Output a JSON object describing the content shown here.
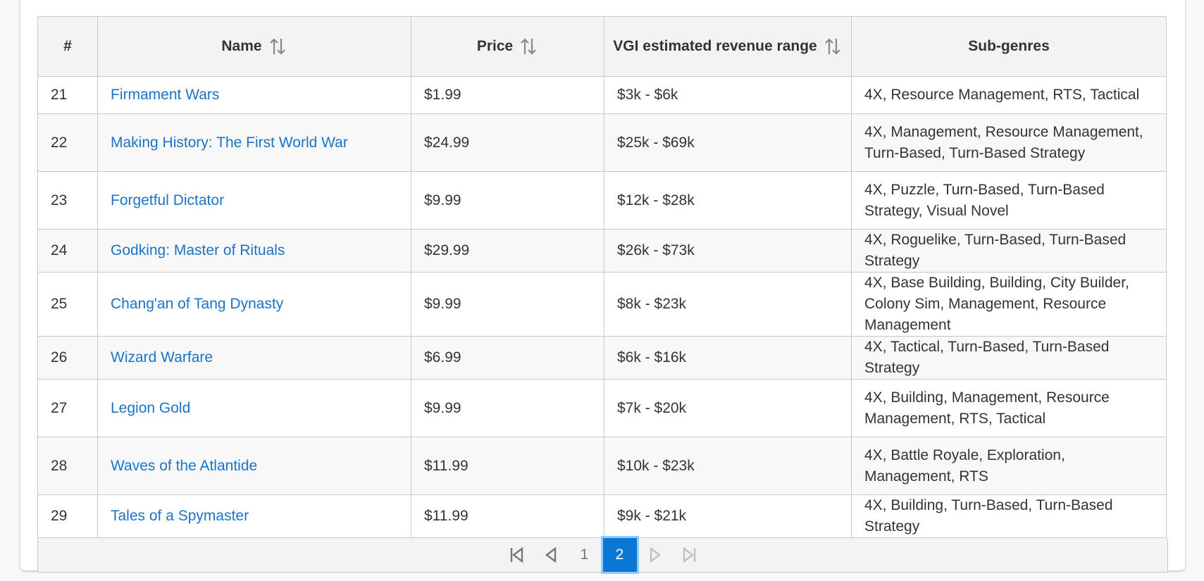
{
  "table": {
    "headers": [
      {
        "label": "#",
        "sortable": false
      },
      {
        "label": "Name",
        "sortable": true
      },
      {
        "label": "Price",
        "sortable": true
      },
      {
        "label": "VGI estimated revenue range",
        "sortable": true
      },
      {
        "label": "Sub-genres",
        "sortable": false
      }
    ],
    "rows": [
      {
        "num": "21",
        "name": "Firmament Wars",
        "price": "$1.99",
        "revenue": "$3k - $6k",
        "subgenres": "4X, Resource Management, RTS, Tactical"
      },
      {
        "num": "22",
        "name": "Making History: The First World War",
        "price": "$24.99",
        "revenue": "$25k - $69k",
        "subgenres": "4X, Management, Resource Management, Turn-Based, Turn-Based Strategy"
      },
      {
        "num": "23",
        "name": "Forgetful Dictator",
        "price": "$9.99",
        "revenue": "$12k - $28k",
        "subgenres": "4X, Puzzle, Turn-Based, Turn-Based Strategy, Visual Novel"
      },
      {
        "num": "24",
        "name": "Godking: Master of Rituals",
        "price": "$29.99",
        "revenue": "$26k - $73k",
        "subgenres": "4X, Roguelike, Turn-Based, Turn-Based Strategy"
      },
      {
        "num": "25",
        "name": "Chang'an of Tang Dynasty",
        "price": "$9.99",
        "revenue": "$8k - $23k",
        "subgenres": "4X, Base Building, Building, City Builder, Colony Sim, Management, Resource Management"
      },
      {
        "num": "26",
        "name": "Wizard Warfare",
        "price": "$6.99",
        "revenue": "$6k - $16k",
        "subgenres": "4X, Tactical, Turn-Based, Turn-Based Strategy"
      },
      {
        "num": "27",
        "name": "Legion Gold",
        "price": "$9.99",
        "revenue": "$7k - $20k",
        "subgenres": "4X, Building, Management, Resource Management, RTS, Tactical"
      },
      {
        "num": "28",
        "name": "Waves of the Atlantide",
        "price": "$11.99",
        "revenue": "$10k - $23k",
        "subgenres": "4X, Battle Royale, Exploration, Management, RTS"
      },
      {
        "num": "29",
        "name": "Tales of a Spymaster",
        "price": "$11.99",
        "revenue": "$9k - $21k",
        "subgenres": "4X, Building, Turn-Based, Turn-Based Strategy"
      }
    ]
  },
  "pagination": {
    "first_icon": "first-page-icon",
    "prev_icon": "previous-page-icon",
    "pages": [
      "1",
      "2"
    ],
    "current_page": "2",
    "next_icon": "next-page-icon",
    "last_icon": "last-page-icon",
    "next_disabled": true,
    "last_disabled": true
  },
  "colors": {
    "link": "#1a73c9",
    "active_page": "#0a77d5",
    "active_page_ring": "#8fcbff",
    "header_bg": "#f3f3f3",
    "stripe_bg": "#f8f8f8",
    "border": "#c8c8c8"
  }
}
